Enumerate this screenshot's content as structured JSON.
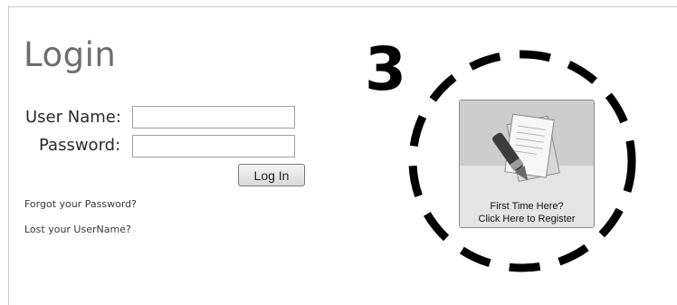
{
  "login": {
    "title": "Login",
    "username_label": "User Name:",
    "username_value": "",
    "password_label": "Password:",
    "password_value": "",
    "login_button": "Log In",
    "forgot_password_link": "Forgot your Password?",
    "lost_username_link": "Lost your UserName?"
  },
  "annotation": {
    "step_number": "3"
  },
  "register": {
    "line1": "First Time Here?",
    "line2": "Click Here to Register",
    "icon": "document-pen-icon"
  }
}
